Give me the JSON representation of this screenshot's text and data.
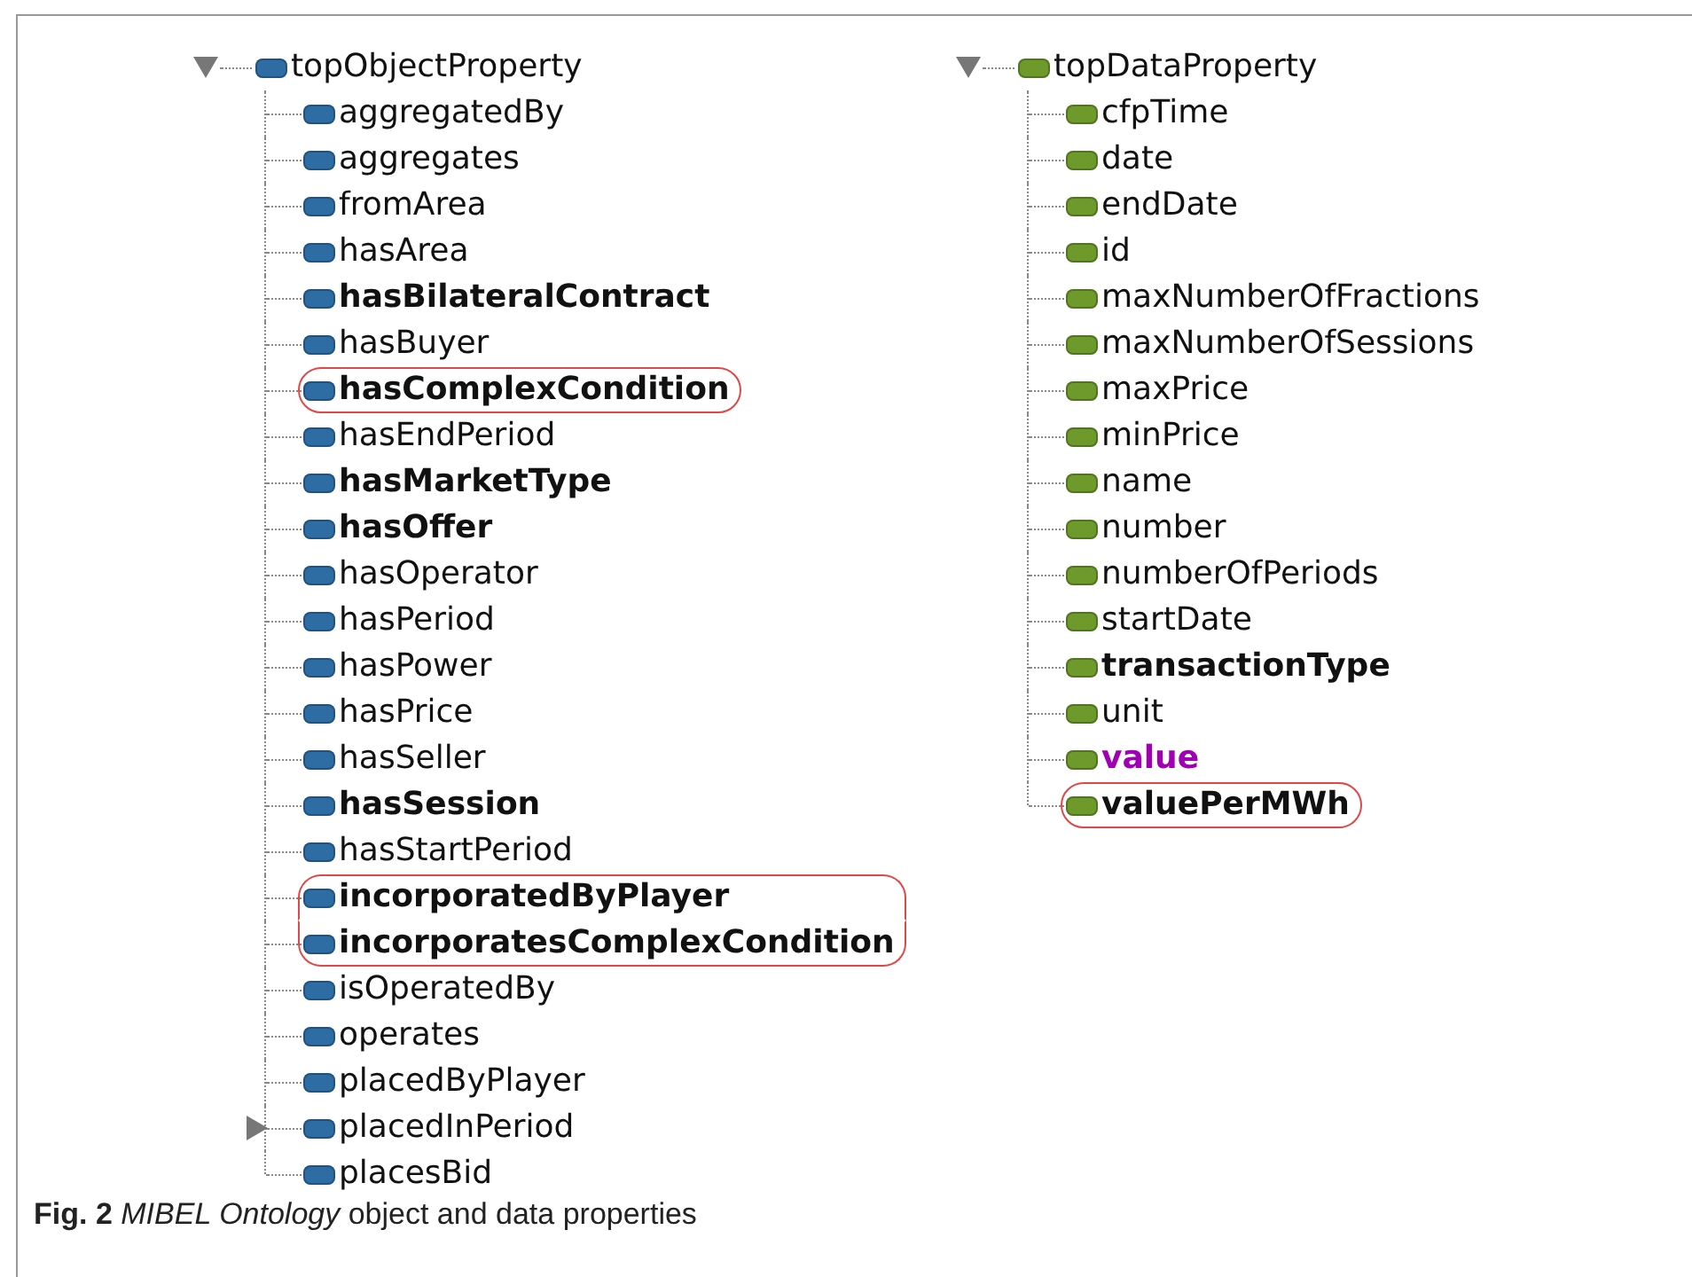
{
  "trees": [
    {
      "color": "#2e6da4",
      "root": {
        "label": "topObjectProperty",
        "expanded": true
      },
      "children": [
        {
          "label": "aggregatedBy",
          "kind": "leaf",
          "bold": false,
          "highlighted": false
        },
        {
          "label": "aggregates",
          "kind": "leaf",
          "bold": false,
          "highlighted": false
        },
        {
          "label": "fromArea",
          "kind": "leaf",
          "bold": false,
          "highlighted": false
        },
        {
          "label": "hasArea",
          "kind": "leaf",
          "bold": false,
          "highlighted": false
        },
        {
          "label": "hasBilateralContract",
          "kind": "leaf",
          "bold": true,
          "highlighted": false
        },
        {
          "label": "hasBuyer",
          "kind": "leaf",
          "bold": false,
          "highlighted": false
        },
        {
          "label": "hasComplexCondition",
          "kind": "leaf",
          "bold": true,
          "highlighted": true
        },
        {
          "label": "hasEndPeriod",
          "kind": "leaf",
          "bold": false,
          "highlighted": false
        },
        {
          "label": "hasMarketType",
          "kind": "leaf",
          "bold": true,
          "highlighted": false
        },
        {
          "label": "hasOffer",
          "kind": "leaf",
          "bold": true,
          "highlighted": false
        },
        {
          "label": "hasOperator",
          "kind": "leaf",
          "bold": false,
          "highlighted": false
        },
        {
          "label": "hasPeriod",
          "kind": "leaf",
          "bold": false,
          "highlighted": false
        },
        {
          "label": "hasPower",
          "kind": "leaf",
          "bold": false,
          "highlighted": false
        },
        {
          "label": "hasPrice",
          "kind": "leaf",
          "bold": false,
          "highlighted": false
        },
        {
          "label": "hasSeller",
          "kind": "leaf",
          "bold": false,
          "highlighted": false
        },
        {
          "label": "hasSession",
          "kind": "leaf",
          "bold": true,
          "highlighted": false
        },
        {
          "label": "hasStartPeriod",
          "kind": "leaf",
          "bold": false,
          "highlighted": false
        },
        {
          "label": "incorporatedByPlayer",
          "kind": "leaf",
          "bold": true,
          "highlighted": true
        },
        {
          "label": "incorporatesComplexCondition",
          "kind": "leaf",
          "bold": true,
          "highlighted": true
        },
        {
          "label": "isOperatedBy",
          "kind": "leaf",
          "bold": false,
          "highlighted": false
        },
        {
          "label": "operates",
          "kind": "leaf",
          "bold": false,
          "highlighted": false
        },
        {
          "label": "placedByPlayer",
          "kind": "leaf",
          "bold": false,
          "highlighted": false
        },
        {
          "label": "placedInPeriod",
          "kind": "collapsed",
          "bold": false,
          "highlighted": false
        },
        {
          "label": "placesBid",
          "kind": "leaf",
          "bold": false,
          "highlighted": false
        }
      ]
    },
    {
      "color": "#6e9a2c",
      "root": {
        "label": "topDataProperty",
        "expanded": true
      },
      "children": [
        {
          "label": "cfpTime",
          "kind": "leaf",
          "bold": false,
          "highlighted": false
        },
        {
          "label": "date",
          "kind": "leaf",
          "bold": false,
          "highlighted": false
        },
        {
          "label": "endDate",
          "kind": "leaf",
          "bold": false,
          "highlighted": false
        },
        {
          "label": "id",
          "kind": "leaf",
          "bold": false,
          "highlighted": false
        },
        {
          "label": "maxNumberOfFractions",
          "kind": "leaf",
          "bold": false,
          "highlighted": false
        },
        {
          "label": "maxNumberOfSessions",
          "kind": "leaf",
          "bold": false,
          "highlighted": false
        },
        {
          "label": "maxPrice",
          "kind": "leaf",
          "bold": false,
          "highlighted": false
        },
        {
          "label": "minPrice",
          "kind": "leaf",
          "bold": false,
          "highlighted": false
        },
        {
          "label": "name",
          "kind": "leaf",
          "bold": false,
          "highlighted": false
        },
        {
          "label": "number",
          "kind": "leaf",
          "bold": false,
          "highlighted": false
        },
        {
          "label": "numberOfPeriods",
          "kind": "leaf",
          "bold": false,
          "highlighted": false
        },
        {
          "label": "startDate",
          "kind": "leaf",
          "bold": false,
          "highlighted": false
        },
        {
          "label": "transactionType",
          "kind": "leaf",
          "bold": true,
          "highlighted": false
        },
        {
          "label": "unit",
          "kind": "leaf",
          "bold": false,
          "highlighted": false
        },
        {
          "label": "value",
          "kind": "leaf",
          "bold": true,
          "highlighted": false,
          "color": "#a000b4"
        },
        {
          "label": "valuePerMWh",
          "kind": "leaf",
          "bold": true,
          "highlighted": true
        }
      ]
    }
  ],
  "caption": "**Fig. 2** *MIBEL Ontology* object and data properties"
}
